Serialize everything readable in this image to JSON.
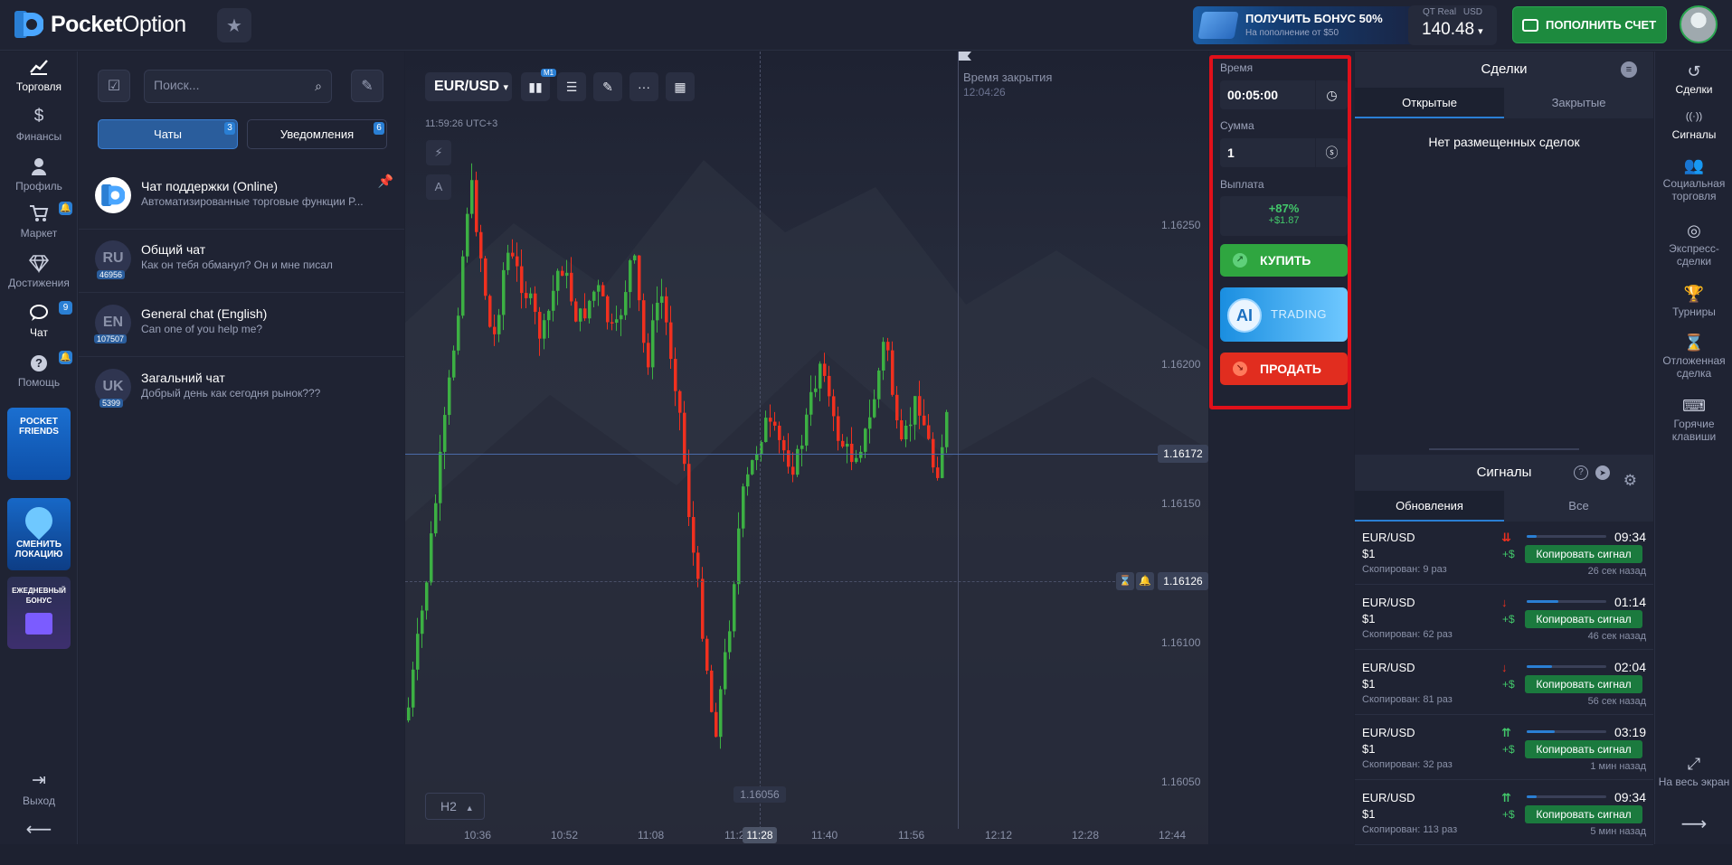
{
  "brand": {
    "name_bold": "Pocket",
    "name_light": "Option"
  },
  "bonus": {
    "title": "ПОЛУЧИТЬ БОНУС 50%",
    "subtitle": "На пополнение от $50",
    "close": "✕"
  },
  "account": {
    "type": "QT Real",
    "currency": "USD",
    "balance": "140.48",
    "arrow": "▾"
  },
  "deposit_label": "ПОПОЛНИТЬ СЧЕТ",
  "leftnav": {
    "items": [
      {
        "label": "Торговля",
        "icon": "chart-line-icon",
        "glyph": "📈"
      },
      {
        "label": "Финансы",
        "icon": "dollar-icon",
        "glyph": "$"
      },
      {
        "label": "Профиль",
        "icon": "user-icon",
        "glyph": "👤"
      },
      {
        "label": "Маркет",
        "icon": "cart-icon",
        "glyph": "🛒"
      },
      {
        "label": "Достижения",
        "icon": "diamond-icon",
        "glyph": "◇"
      },
      {
        "label": "Чат",
        "icon": "chat-icon",
        "glyph": "💬",
        "badge": "9"
      },
      {
        "label": "Помощь",
        "icon": "help-icon",
        "glyph": "?"
      }
    ],
    "promos": [
      {
        "label": "POCKET FRIENDS"
      },
      {
        "label": "СМЕНИТЬ ЛОКАЦИЮ"
      },
      {
        "label": "ЕЖЕДНЕВНЫЙ БОНУС"
      }
    ],
    "logout": "Выход",
    "back_arrow": "⟵"
  },
  "chat": {
    "search_placeholder": "Поиск...",
    "tabs": [
      {
        "label": "Чаты",
        "badge": "3"
      },
      {
        "label": "Уведомления",
        "badge": "6"
      }
    ],
    "items": [
      {
        "name": "Чат поддержки (Online)",
        "message": "Автоматизированные торговые функции P...",
        "avatar": "",
        "count": ""
      },
      {
        "name": "Общий чат",
        "message": "Как он тебя обманул? Он и мне писал",
        "avatar": "RU",
        "count": "46956"
      },
      {
        "name": "General chat (English)",
        "message": "Can one of you help me?",
        "avatar": "EN",
        "count": "107507"
      },
      {
        "name": "Загальний чат",
        "message": "Добрый день как сегодня рынок???",
        "avatar": "UK",
        "count": "5399"
      }
    ]
  },
  "chart": {
    "pair": "EUR/USD",
    "timeframe_badge": "M1",
    "server_time": "11:59:26 UTC+3",
    "close_label": "Время закрытия",
    "close_time": "12:04:26",
    "current_price": "1.16172",
    "open_price": "1.16126",
    "min_price": "1.16056",
    "price_ticks": [
      "1.16250",
      "1.16200",
      "1.16150",
      "1.16100",
      "1.16050"
    ],
    "time_ticks": [
      "10:36",
      "10:52",
      "11:08",
      "11:24",
      "11:40",
      "11:56",
      "12:12",
      "12:28",
      "12:44"
    ],
    "current_time": "11:28",
    "interval": "H2",
    "tool_a": "A",
    "colors": {
      "up": "#3cb043",
      "down": "#f0301f"
    }
  },
  "chart_data": {
    "type": "candlestick",
    "x": [
      "10:36",
      "10:52",
      "11:08",
      "11:24",
      "11:40",
      "11:56"
    ],
    "close_price": 1.16172,
    "ylim": [
      1.1604,
      1.1628
    ]
  },
  "trade": {
    "time_label": "Время",
    "time_value": "00:05:00",
    "amount_label": "Сумма",
    "amount_value": "1",
    "payout_label": "Выплата",
    "payout_pct": "+87%",
    "payout_amt": "+$1.87",
    "buy_label": "КУПИТЬ",
    "ai_short": "AI",
    "ai_label": "TRADING",
    "sell_label": "ПРОДАТЬ"
  },
  "deals": {
    "title": "Сделки",
    "tab_open": "Открытые",
    "tab_closed": "Закрытые",
    "empty": "Нет размещенных сделок"
  },
  "signals": {
    "title": "Сигналы",
    "tab_updates": "Обновления",
    "tab_all": "Все",
    "copy_label": "Копировать сигнал",
    "rows": [
      {
        "pair": "EUR/USD",
        "amount": "$1",
        "copied": "Скопирован: 9 раз",
        "dir": "down2",
        "time": "09:34",
        "ago": "26 сек назад",
        "progress": 0.12
      },
      {
        "pair": "EUR/USD",
        "amount": "$1",
        "copied": "Скопирован: 62 раз",
        "dir": "down",
        "time": "01:14",
        "ago": "46 сек назад",
        "progress": 0.4
      },
      {
        "pair": "EUR/USD",
        "amount": "$1",
        "copied": "Скопирован: 81 раз",
        "dir": "down",
        "time": "02:04",
        "ago": "56 сек назад",
        "progress": 0.32
      },
      {
        "pair": "EUR/USD",
        "amount": "$1",
        "copied": "Скопирован: 32 раз",
        "dir": "up2",
        "time": "03:19",
        "ago": "1 мин назад",
        "progress": 0.35
      },
      {
        "pair": "EUR/USD",
        "amount": "$1",
        "copied": "Скопирован: 113 раз",
        "dir": "up2",
        "time": "09:34",
        "ago": "5 мин назад",
        "progress": 0.12
      }
    ]
  },
  "rightnav": {
    "items": [
      {
        "label": "Сделки",
        "icon": "history-icon",
        "glyph": "↺"
      },
      {
        "label": "Сигналы",
        "icon": "signal-icon",
        "glyph": "((·))"
      },
      {
        "label": "Социальная торговля",
        "icon": "people-icon",
        "glyph": "👥"
      },
      {
        "label": "Экспресс-сделки",
        "icon": "target-icon",
        "glyph": "◎"
      },
      {
        "label": "Турниры",
        "icon": "trophy-icon",
        "glyph": "🏆"
      },
      {
        "label": "Отложенная сделка",
        "icon": "hourglass-icon",
        "glyph": "⌛"
      },
      {
        "label": "Горячие клавиши",
        "icon": "keyboard-icon",
        "glyph": "⌨"
      }
    ],
    "fullscreen": "На весь экран",
    "arrow": "⟶"
  }
}
